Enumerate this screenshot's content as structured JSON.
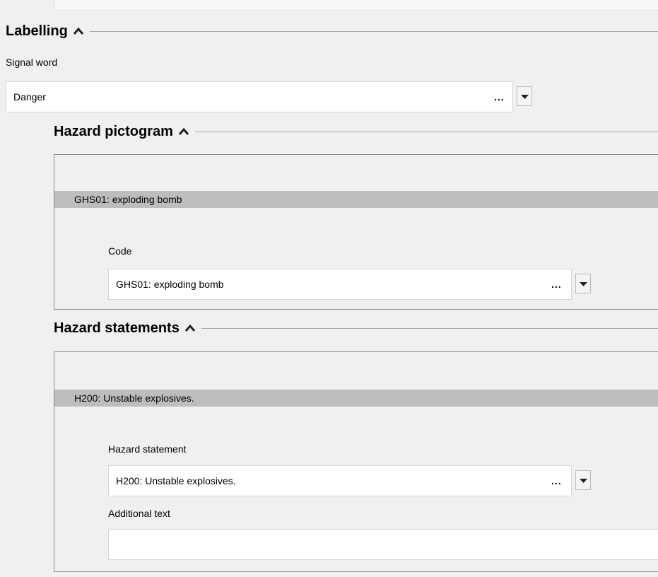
{
  "labelling": {
    "title": "Labelling",
    "signal_word_label": "Signal word",
    "signal_word_value": "Danger",
    "more_label": "..."
  },
  "hazard_pictogram": {
    "title": "Hazard pictogram",
    "entry_header": "GHS01: exploding bomb",
    "code_label": "Code",
    "code_value": "GHS01: exploding bomb",
    "more_label": "..."
  },
  "hazard_statements": {
    "title": "Hazard statements",
    "entry_header": "H200: Unstable explosives.",
    "statement_label": "Hazard statement",
    "statement_value": "H200: Unstable explosives.",
    "more_label": "...",
    "additional_text_label": "Additional text",
    "additional_text_value": ""
  },
  "icons": {
    "collapse": "chevron-up-icon",
    "dropdown": "triangle-down-icon"
  }
}
